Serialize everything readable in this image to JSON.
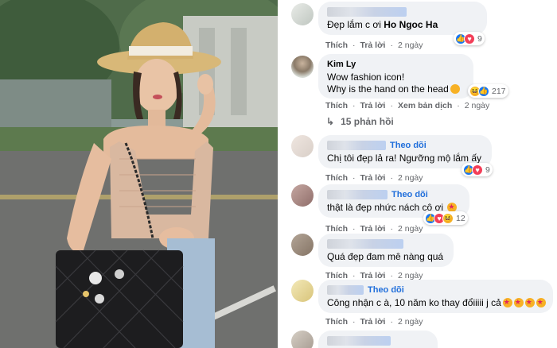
{
  "comments": [
    {
      "name_visible": "",
      "follow_label": "",
      "text": "Đẹp lắm c ơi ",
      "mention": "Ho Ngoc Ha",
      "actions": {
        "like": "Thích",
        "reply": "Trả lời",
        "time": "2 ngày"
      },
      "reactions": {
        "icons": [
          "like-icon",
          "heart-icon"
        ],
        "count": "9"
      }
    },
    {
      "name_visible": "Kim Ly",
      "follow_label": "",
      "line1": "Wow fashion icon!",
      "line2": "Why is the hand on the head",
      "actions": {
        "like": "Thích",
        "reply": "Trả lời",
        "translate": "Xem bản dịch",
        "time": "2 ngày"
      },
      "reactions": {
        "icons": [
          "haha-icon",
          "like-icon"
        ],
        "count": "217"
      },
      "replies_label": "15 phản hồi"
    },
    {
      "follow_label": "Theo dõi",
      "text": "Chị tôi đẹp lả ra! Ngưỡng mộ lắm ấy",
      "actions": {
        "like": "Thích",
        "reply": "Trả lời",
        "time": "2 ngày"
      },
      "reactions": {
        "icons": [
          "like-icon",
          "heart-icon"
        ],
        "count": "9"
      }
    },
    {
      "follow_label": "Theo dõi",
      "text": "thật là đẹp nhức nách cô ơi ",
      "actions": {
        "like": "Thích",
        "reply": "Trả lời",
        "time": "2 ngày"
      },
      "reactions": {
        "icons": [
          "like-icon",
          "heart-icon",
          "haha-icon"
        ],
        "count": "12"
      }
    },
    {
      "follow_label": "",
      "text": "Quá đẹp đam mê nàng quá",
      "actions": {
        "like": "Thích",
        "reply": "Trả lời",
        "time": "2 ngày"
      }
    },
    {
      "follow_label": "Theo dõi",
      "text": "Công nhận c à, 10 năm ko thay đổiiiii j cả",
      "actions": {
        "like": "Thích",
        "reply": "Trả lời",
        "time": "2 ngày"
      }
    }
  ],
  "colors": {
    "bubble": "#f0f2f5",
    "follow": "#216fdb",
    "muted": "#65676b",
    "like": "#1877f2",
    "heart": "#f33e58",
    "haha": "#f7b125"
  }
}
